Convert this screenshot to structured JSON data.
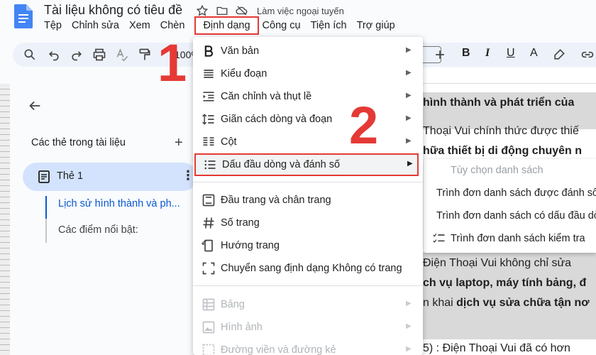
{
  "header": {
    "doc_title": "Tài liệu không có tiêu đề",
    "offline_status": "Làm việc ngoại tuyến",
    "menu": [
      {
        "label": "Tệp",
        "active": false
      },
      {
        "label": "Chỉnh sửa",
        "active": false
      },
      {
        "label": "Xem",
        "active": false
      },
      {
        "label": "Chèn",
        "active": false
      },
      {
        "label": "Định dạng",
        "active": true
      },
      {
        "label": "Công cụ",
        "active": false
      },
      {
        "label": "Tiện ích",
        "active": false
      },
      {
        "label": "Trợ giúp",
        "active": false
      }
    ]
  },
  "toolbar": {
    "zoom": "100%",
    "icons": [
      "search-icon",
      "undo-icon",
      "redo-icon",
      "print-icon",
      "spellcheck-icon",
      "paint-format-icon",
      "plus-icon",
      "bold-icon",
      "italic-icon",
      "underline-icon",
      "text-color-icon",
      "highlight-icon",
      "link-icon"
    ],
    "bold_label": "B",
    "italic_label": "I",
    "underline_label": "U",
    "text_color_label": "A"
  },
  "annotations": {
    "step1": "1",
    "step2": "2",
    "color": "#e53935"
  },
  "sidebar": {
    "outline_title": "Các thẻ trong tài liệu",
    "add_symbol": "+",
    "tab_label": "Thẻ 1",
    "headings": [
      "Lịch sử hình thành và ph...",
      "Các điểm nổi bật:"
    ]
  },
  "format_menu": {
    "items": [
      {
        "label": "Văn bản",
        "icon": "bold-icon",
        "submenu": true,
        "disabled": false
      },
      {
        "label": "Kiểu đoạn",
        "icon": "paragraph-style-icon",
        "submenu": true,
        "disabled": false
      },
      {
        "label": "Căn chỉnh và thụt lề",
        "icon": "align-indent-icon",
        "submenu": true,
        "disabled": false
      },
      {
        "label": "Giãn cách dòng và đoạn",
        "icon": "line-spacing-icon",
        "submenu": true,
        "disabled": false
      },
      {
        "label": "Cột",
        "icon": "columns-icon",
        "submenu": true,
        "disabled": false
      },
      {
        "label": "Dấu đầu dòng và đánh số",
        "icon": "bulleted-list-icon",
        "submenu": true,
        "disabled": false,
        "highlighted": true
      },
      {
        "label": "Đầu trang và chân trang",
        "icon": "header-footer-icon",
        "submenu": false,
        "disabled": false
      },
      {
        "label": "Số trang",
        "icon": "hash-icon",
        "submenu": false,
        "disabled": false
      },
      {
        "label": "Hướng trang",
        "icon": "page-orientation-icon",
        "submenu": false,
        "disabled": false
      },
      {
        "label": "Chuyển sang định dạng Không có trang",
        "icon": "pageless-icon",
        "submenu": false,
        "disabled": false
      },
      {
        "label": "Bảng",
        "icon": "table-icon",
        "submenu": true,
        "disabled": true
      },
      {
        "label": "Hình ảnh",
        "icon": "image-icon",
        "submenu": true,
        "disabled": true
      },
      {
        "label": "Đường viền và đường kẻ",
        "icon": "borders-icon",
        "submenu": true,
        "disabled": true
      }
    ]
  },
  "list_submenu": {
    "items": [
      {
        "label": "Tùy chọn danh sách",
        "disabled": true
      },
      {
        "label": "Trình đơn danh sách được đánh số",
        "icon": "numbered-list-icon"
      },
      {
        "label": "Trình đơn danh sách có dấu đầu dòng",
        "icon": "bulleted-list-icon"
      },
      {
        "label": "Trình đơn danh sách kiểm tra",
        "icon": "checklist-icon"
      }
    ]
  },
  "document": {
    "lines": [
      {
        "text": "hình thành và phát triển của",
        "bold": true
      },
      {
        "text": "Thoại Vui chính thức được thiế",
        "bold": false
      },
      {
        "text": "hữa thiết bị di động chuyên n",
        "bold": true
      },
      {
        "text": "Điện Thoại Vui không chỉ sửa",
        "bold": false
      },
      {
        "text": "ch vụ laptop, máy tính bảng, đ",
        "bold": true
      },
      {
        "text_prefix": "n khai ",
        "text_bold": "dịch vụ sửa chữa tận nơ"
      },
      {
        "text": "5) : Điện Thoại Vui đã có hơn",
        "bold": false
      }
    ]
  }
}
